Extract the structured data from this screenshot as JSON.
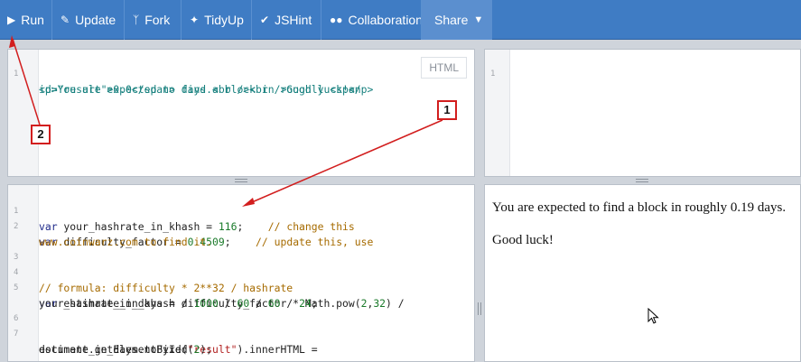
{
  "toolbar": {
    "run_label": "Run",
    "update_label": "Update",
    "fork_label": "Fork",
    "tidyup_label": "TidyUp",
    "jshint_label": "JSHint",
    "collaboration_label": "Collaboration",
    "share_label": "Share"
  },
  "html_editor": {
    "badge": "HTML",
    "line_numbers": [
      "1"
    ],
    "line1a": "<p>You are expected to find a block in roughly <span",
    "line1b": "id=\"result\">0.0</span> days.<br /><br />Good luck!</p>"
  },
  "css_editor": {
    "line_numbers": [
      "1"
    ]
  },
  "js_editor": {
    "line_numbers": [
      "1",
      "2",
      "",
      "3",
      "4",
      "5",
      "",
      "6",
      "7",
      ""
    ],
    "l1_kw": "var",
    "l1_code": " your_hashrate_in_khash = ",
    "l1_num": "116",
    "l1_end": ";",
    "l1_cm": "// change this",
    "l2_kw": "var",
    "l2_code": " difficulty_factor = ",
    "l2_num": "0.4509",
    "l2_end": ";",
    "l2_cm": "// update this, use",
    "l2_cont": "www.coinwarz.com to find it.",
    "l4_cm": "// formula: difficulty * 2**32 / hashrate",
    "l5_kw": "var",
    "l5_code": " estimate_in_days = difficulty_factor * Math.pow(",
    "l5_n1": "2",
    "l5_comma": ",",
    "l5_n2": "32",
    "l5_end": ") /",
    "l5_cont_a": "your_hashrate_in_khash / ",
    "l5_n3": "1000",
    "l5_s1": " / ",
    "l5_n4": "60",
    "l5_s2": " / ",
    "l5_n5": "60",
    "l5_s3": " / ",
    "l5_n6": "24",
    "l5_s4": ";",
    "l7_code": "document.getElementById(",
    "l7_str": "\"result\"",
    "l7_end": ").innerHTML =",
    "l7_cont_a": "estimate_in_days.toFixed(",
    "l7_n": "2",
    "l7_cont_b": ");"
  },
  "result": {
    "line1": "You are expected to find a block in roughly 0.19 days.",
    "line2": "Good luck!"
  },
  "callouts": {
    "one": "1",
    "two": "2"
  },
  "colors": {
    "toolbar": "#3f7cc4",
    "annotation": "#d21e1e"
  }
}
